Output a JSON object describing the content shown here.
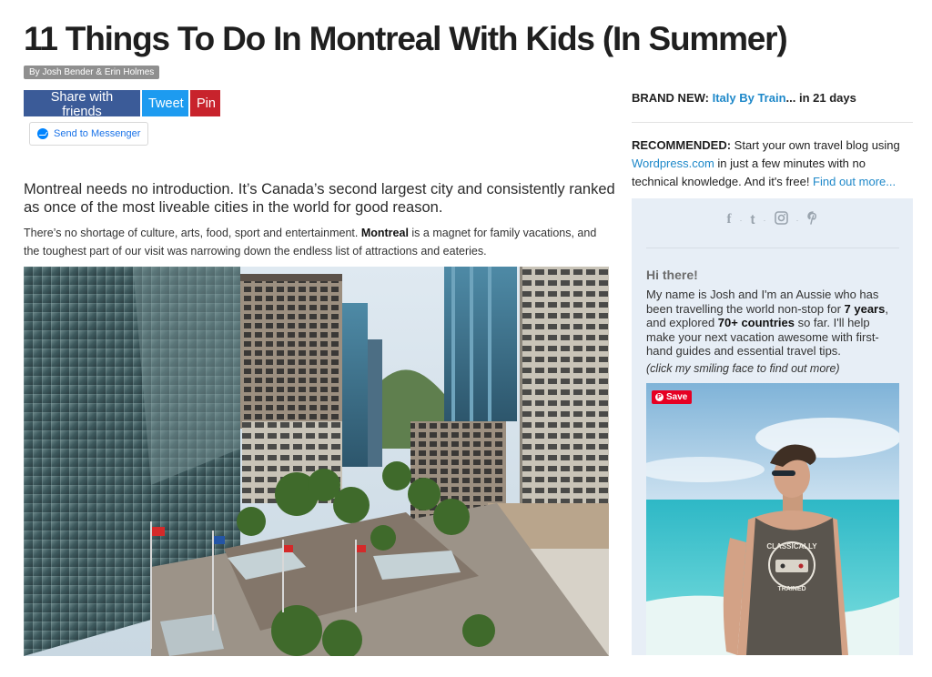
{
  "article": {
    "title": "11 Things To Do In Montreal With Kids (In Summer)",
    "byline": "By Josh Bender & Erin Holmes",
    "share": {
      "facebook": "Share with friends",
      "twitter": "Tweet",
      "pinterest": "Pin",
      "messenger": "Send to Messenger"
    },
    "intro": "Montreal needs no introduction. It’s Canada’s second largest city and consistently ranked as once of the most liveable cities in the world for good reason.",
    "para_before": "There’s no shortage of culture, arts, food, sport and entertainment. ",
    "para_bold": "Montreal",
    "para_after": " is a magnet for family vacations, and the toughest part of our visit was narrowing down the endless list of attractions and eateries."
  },
  "sidebar": {
    "brand_new_label": "BRAND NEW: ",
    "brand_new_link": "Italy By Train",
    "brand_new_suffix": "... in 21 days",
    "recommended_label": "RECOMMENDED:",
    "recommended_text_1": " Start your own travel blog using ",
    "recommended_link": "Wordpress.com",
    "recommended_text_2": " in just a few minutes with no technical knowledge. And it's free! ",
    "recommended_more": "Find out more...",
    "social_icons": [
      "facebook-icon",
      "twitter-icon",
      "instagram-icon",
      "pinterest-icon"
    ],
    "hi": "Hi there!",
    "bio_1": "My name is Josh and I'm an Aussie who has been travelling the world non-stop for ",
    "bio_years": "7 years",
    "bio_2": ", and explored ",
    "bio_countries": "70+ countries",
    "bio_3": " so far. I'll help make your next vacation awesome with first-hand guides and essential travel tips.",
    "click_note": "(click my smiling face to find out more)",
    "save_label": "Save",
    "shirt_top": "CLASSICALLY",
    "shirt_bottom": "TRAINED"
  },
  "colors": {
    "facebook": "#3b5b98",
    "twitter": "#1d9bf0",
    "pinterest": "#c8232c",
    "link": "#1e88c9",
    "sidebar_box": "#e7eef6"
  }
}
